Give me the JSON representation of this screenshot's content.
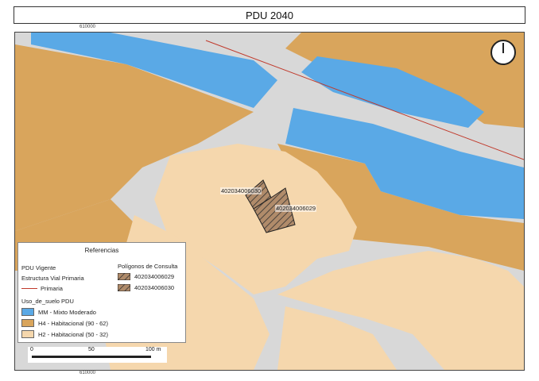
{
  "title": "PDU 2040",
  "coords": {
    "top": "610000",
    "bottom": "610000"
  },
  "parcels": [
    "402034006030",
    "402034006029"
  ],
  "legend": {
    "title": "Referencias",
    "pdu_vigente": "PDU Vigente",
    "estructura_vial": "Estructura Vial Primaria",
    "primaria": "Primaria",
    "consulta_title": "Polígonos de Consulta",
    "consulta_items": [
      "402034006029",
      "402034006030"
    ],
    "uso_title": "Uso_de_suelo PDU",
    "uso_items": [
      {
        "label": "MM - Mixto Moderado",
        "color": "#5aa9e6"
      },
      {
        "label": "H4 - Habitacional (90 - 62)",
        "color": "#d9a55c"
      },
      {
        "label": "H2 - Habitacional (50 - 32)",
        "color": "#f5d7ad"
      }
    ]
  },
  "scale": {
    "ticks": [
      "0",
      "50",
      "100 m"
    ]
  },
  "colors": {
    "road": "#d8d8d8",
    "primaria_line": "#c0392b"
  },
  "icons": {
    "north_arrow": "north-arrow-icon"
  }
}
